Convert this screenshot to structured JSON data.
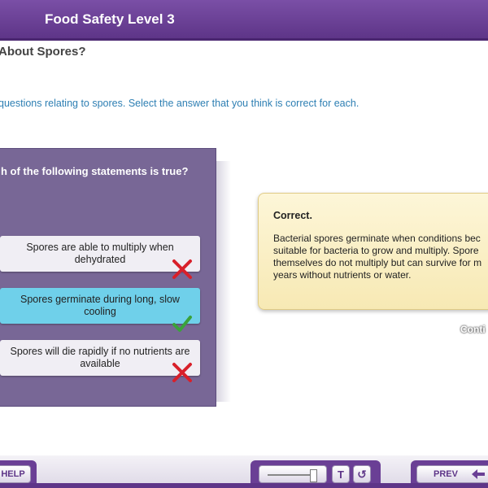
{
  "header": {
    "title": "Food Safety Level 3"
  },
  "page": {
    "heading": "About Spores?",
    "instructions": "questions relating to spores. Select the answer that you think is correct for each."
  },
  "question": {
    "text": "h of the following statements is true?",
    "options": [
      {
        "label": "Spores are able to multiply when dehydrated",
        "result": "incorrect"
      },
      {
        "label": "Spores germinate during long, slow cooling",
        "result": "correct"
      },
      {
        "label": "Spores will die rapidly if no nutrients are available",
        "result": "incorrect"
      }
    ]
  },
  "feedback": {
    "title": "Correct.",
    "text": "Bacterial spores germinate when conditions bec\nsuitable for bacteria to grow and multiply. Spore\nthemselves do not multiply but can survive for m\nyears without nutrients or water."
  },
  "continue_label": "Conti",
  "footer": {
    "help_label": "HELP",
    "text_button": "T",
    "replay_icon": "↺",
    "prev_label": "PREV"
  },
  "colors": {
    "header": "#6a3f95",
    "panel": "#786796",
    "selected": "#6fd0ea",
    "correct": "#3aa23a",
    "incorrect": "#d8202a"
  }
}
